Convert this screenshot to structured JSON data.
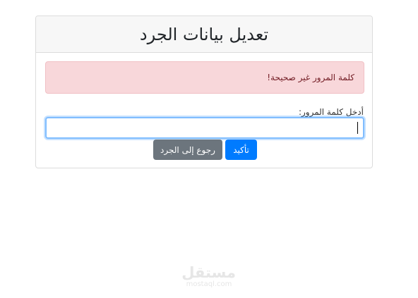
{
  "card": {
    "title": "تعديل بيانات الجرد"
  },
  "alert": {
    "message": "كلمة المرور غير صحيحة!",
    "color": "#f8d7da"
  },
  "form": {
    "password_label": "أدخل كلمة المرور:",
    "password_value": ""
  },
  "buttons": {
    "confirm_label": "تأكيد",
    "back_label": "رجوع إلى الجرد",
    "confirm_color": "#007bff",
    "back_color": "#6c757d"
  },
  "watermark": {
    "arabic": "مستقل",
    "latin": "mostaql.com"
  }
}
